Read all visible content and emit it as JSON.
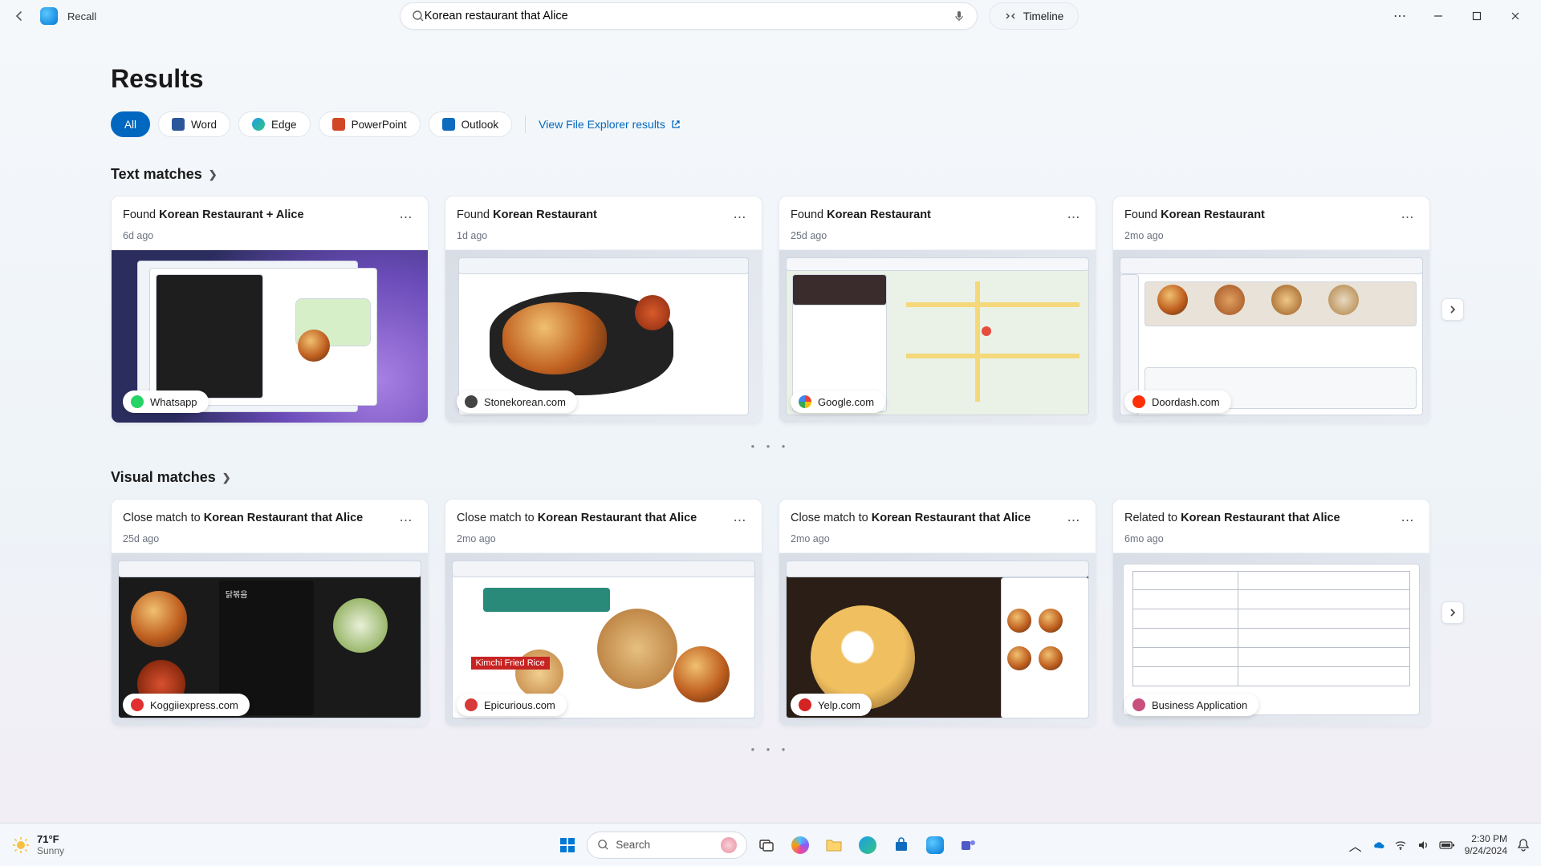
{
  "app": {
    "title": "Recall"
  },
  "search": {
    "value": "Korean restaurant that Alice"
  },
  "timeline_btn": "Timeline",
  "page_title": "Results",
  "filters": {
    "all": "All",
    "items": [
      {
        "label": "Word",
        "color": "#2b579a"
      },
      {
        "label": "Edge",
        "color": "#1e9de7"
      },
      {
        "label": "PowerPoint",
        "color": "#d24726"
      },
      {
        "label": "Outlook",
        "color": "#0f6cbd"
      }
    ],
    "link": "View File Explorer results"
  },
  "sections": {
    "text": {
      "title": "Text matches"
    },
    "visual": {
      "title": "Visual matches"
    }
  },
  "text_cards": [
    {
      "prefix": "Found ",
      "bold": "Korean Restaurant + Alice",
      "time": "6d ago",
      "badge": "Whatsapp",
      "badge_color": "#25d366"
    },
    {
      "prefix": "Found ",
      "bold": "Korean Restaurant",
      "time": "1d ago",
      "badge": "Stonekorean.com",
      "badge_color": "#444"
    },
    {
      "prefix": "Found ",
      "bold": "Korean Restaurant",
      "time": "25d ago",
      "badge": "Google.com",
      "badge_color": "#ea4335"
    },
    {
      "prefix": "Found ",
      "bold": "Korean Restaurant",
      "time": "2mo ago",
      "badge": "Doordash.com",
      "badge_color": "#ff3008"
    }
  ],
  "visual_cards": [
    {
      "prefix": "Close match to ",
      "bold": "Korean Restaurant that Alice",
      "time": "25d ago",
      "badge": "Koggiiexpress.com",
      "badge_color": "#e03030"
    },
    {
      "prefix": "Close match to ",
      "bold": "Korean Restaurant that Alice",
      "time": "2mo ago",
      "badge": "Epicurious.com",
      "badge_color": "#d83a3a"
    },
    {
      "prefix": "Close match to ",
      "bold": "Korean Restaurant that Alice",
      "time": "2mo ago",
      "badge": "Yelp.com",
      "badge_color": "#d32323"
    },
    {
      "prefix": "Related to ",
      "bold": "Korean Restaurant that Alice",
      "time": "6mo ago",
      "badge": "Business Application",
      "badge_color": "#c94f7c"
    }
  ],
  "taskbar": {
    "weather_temp": "71°F",
    "weather_desc": "Sunny",
    "search_placeholder": "Search",
    "time": "2:30 PM",
    "date": "9/24/2024"
  }
}
